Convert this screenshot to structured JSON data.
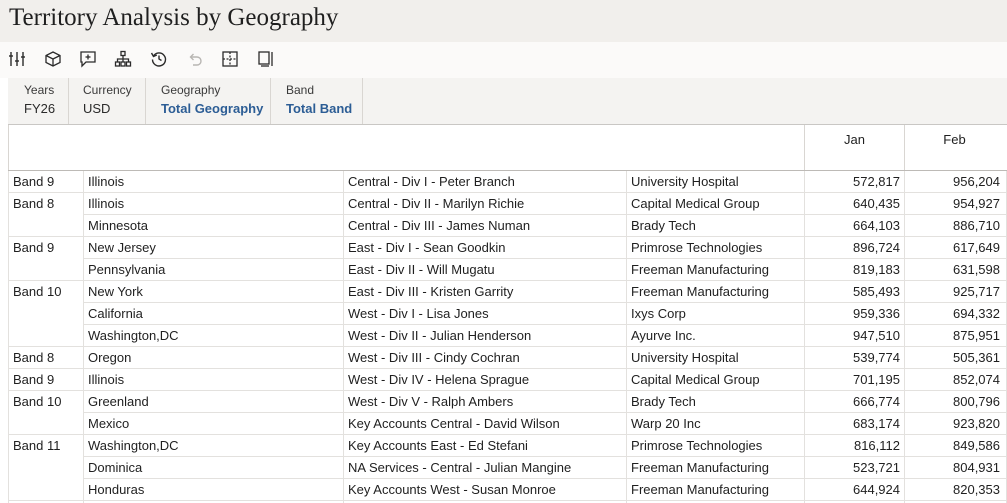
{
  "page": {
    "title": "Territory Analysis by Geography"
  },
  "toolbar": {
    "icons": [
      "sliders-icon",
      "cube-icon",
      "comment-add-icon",
      "hierarchy-icon",
      "history-icon",
      "undo-icon",
      "grid-icon",
      "panel-icon"
    ]
  },
  "pov": [
    {
      "label": "Years",
      "value": "FY26"
    },
    {
      "label": "Currency",
      "value": "USD"
    },
    {
      "label": "Geography",
      "value": "Total Geography"
    },
    {
      "label": "Band",
      "value": "Total Band"
    }
  ],
  "grid": {
    "columns": [
      "Jan",
      "Feb"
    ],
    "rows": [
      {
        "band": "Band 9",
        "state": "Illinois",
        "division": "Central -  Div I - Peter Branch",
        "customer": "University Hospital",
        "jan": "572,817",
        "feb": "956,204"
      },
      {
        "band": "Band 8",
        "state": "Illinois",
        "division": "Central -  Div II - Marilyn Richie",
        "customer": "Capital Medical Group",
        "jan": "640,435",
        "feb": "954,927"
      },
      {
        "band": "",
        "state": "Minnesota",
        "division": "Central -  Div III - James Numan",
        "customer": "Brady Tech",
        "jan": "664,103",
        "feb": "886,710"
      },
      {
        "band": "Band 9",
        "state": "New Jersey",
        "division": "East -  Div I - Sean Goodkin",
        "customer": "Primrose Technologies",
        "jan": "896,724",
        "feb": "617,649"
      },
      {
        "band": "",
        "state": "Pennsylvania",
        "division": "East -  Div II - Will Mugatu",
        "customer": "Freeman Manufacturing",
        "jan": "819,183",
        "feb": "631,598"
      },
      {
        "band": "Band 10",
        "state": "New York",
        "division": "East -  Div III - Kristen Garrity",
        "customer": "Freeman Manufacturing",
        "jan": "585,493",
        "feb": "925,717"
      },
      {
        "band": "",
        "state": "California",
        "division": "West -  Div I - Lisa Jones",
        "customer": "Ixys Corp",
        "jan": "959,336",
        "feb": "694,332"
      },
      {
        "band": "",
        "state": "Washington,DC",
        "division": "West -  Div II - Julian Henderson",
        "customer": "Ayurve Inc.",
        "jan": "947,510",
        "feb": "875,951"
      },
      {
        "band": "Band 8",
        "state": "Oregon",
        "division": "West -  Div III - Cindy Cochran",
        "customer": "University Hospital",
        "jan": "539,774",
        "feb": "505,361"
      },
      {
        "band": "Band 9",
        "state": "Illinois",
        "division": "West -  Div IV - Helena Sprague",
        "customer": "Capital Medical Group",
        "jan": "701,195",
        "feb": "852,074"
      },
      {
        "band": "Band 10",
        "state": "Greenland",
        "division": "West -  Div V - Ralph Ambers",
        "customer": "Brady Tech",
        "jan": "666,774",
        "feb": "800,796"
      },
      {
        "band": "",
        "state": "Mexico",
        "division": "Key Accounts Central - David Wilson",
        "customer": "Warp 20 Inc",
        "jan": "683,174",
        "feb": "923,820"
      },
      {
        "band": "Band 11",
        "state": "Washington,DC",
        "division": "Key Accounts East - Ed Stefani",
        "customer": "Primrose Technologies",
        "jan": "816,112",
        "feb": "849,586"
      },
      {
        "band": "",
        "state": "Dominica",
        "division": "NA Services - Central - Julian Mangine",
        "customer": "Freeman Manufacturing",
        "jan": "523,721",
        "feb": "804,931"
      },
      {
        "band": "",
        "state": "Honduras",
        "division": "Key Accounts West - Susan Monroe",
        "customer": "Freeman Manufacturing",
        "jan": "644,924",
        "feb": "820,353"
      }
    ]
  }
}
